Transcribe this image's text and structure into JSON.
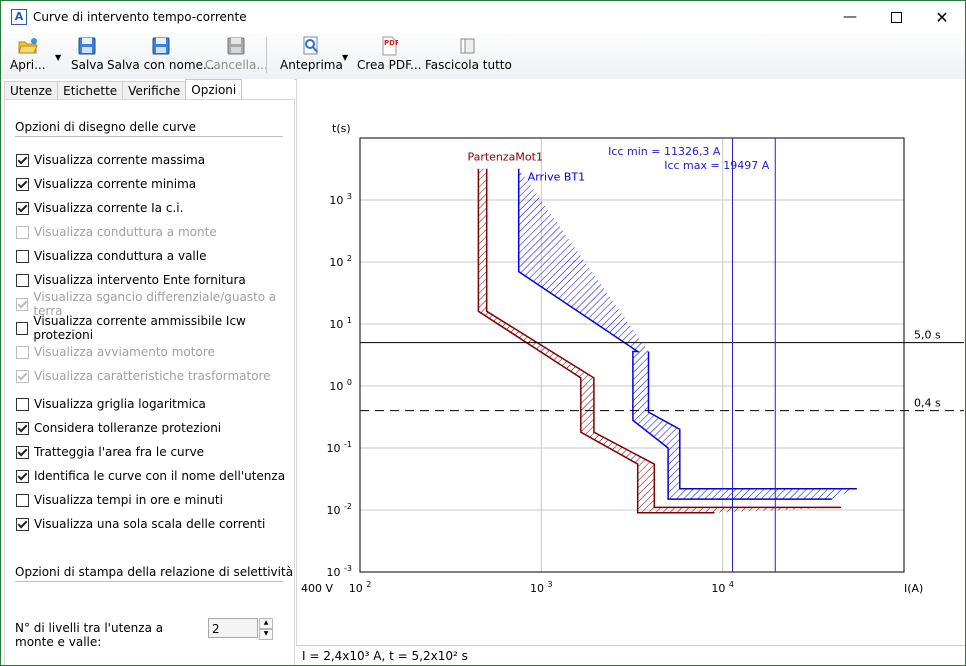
{
  "window": {
    "title": "Curve di intervento tempo-corrente"
  },
  "toolbar": {
    "open": "Apri...",
    "save": "Salva",
    "save_as": "Salva con nome...",
    "delete": "Cancella...",
    "preview": "Anteprima",
    "pdf": "Crea PDF...",
    "collate": "Fascicola tutto"
  },
  "tabs": [
    "Utenze",
    "Etichette",
    "Verifiche",
    "Opzioni"
  ],
  "drawing": {
    "title": "Opzioni di disegno delle curve",
    "options": [
      {
        "label": "Visualizza corrente massima",
        "checked": true,
        "enabled": true
      },
      {
        "label": "Visualizza corrente minima",
        "checked": true,
        "enabled": true
      },
      {
        "label": "Visualizza corrente Ia c.i.",
        "checked": true,
        "enabled": true
      },
      {
        "label": "Visualizza conduttura a monte",
        "checked": false,
        "enabled": false
      },
      {
        "label": "Visualizza conduttura a valle",
        "checked": false,
        "enabled": true
      },
      {
        "label": "Visualizza intervento Ente fornitura",
        "checked": false,
        "enabled": true
      },
      {
        "label": "Visualizza sgancio differenziale/guasto a terra",
        "checked": true,
        "enabled": false
      },
      {
        "label": "Visualizza corrente ammissibile Icw protezioni",
        "checked": false,
        "enabled": true
      },
      {
        "label": "Visualizza avviamento motore",
        "checked": false,
        "enabled": false
      },
      {
        "label": "Visualizza caratteristiche trasformatore",
        "checked": true,
        "enabled": false
      },
      {
        "label": "Visualizza griglia logaritmica",
        "checked": false,
        "enabled": true
      },
      {
        "label": "Considera tolleranze protezioni",
        "checked": true,
        "enabled": true
      },
      {
        "label": "Tratteggia l'area fra le curve",
        "checked": true,
        "enabled": true
      },
      {
        "label": "Identifica le curve con il nome dell'utenza",
        "checked": true,
        "enabled": true
      },
      {
        "label": "Visualizza tempi in ore e minuti",
        "checked": false,
        "enabled": true
      },
      {
        "label": "Visualizza una sola scala delle correnti",
        "checked": true,
        "enabled": true
      }
    ]
  },
  "print": {
    "title": "Opzioni di stampa della relazione di selettività",
    "levels_label": "N° di livelli tra l'utenza a monte e valle:",
    "levels_value": "2"
  },
  "chart_data": {
    "type": "line",
    "xlabel": "I(A)",
    "ylabel": "t(s)",
    "voltage": "400 V",
    "x_scale": "log",
    "y_scale": "log",
    "xlim": [
      100,
      100000
    ],
    "ylim": [
      0.001,
      10000
    ],
    "x_ticks": [
      {
        "base": "10",
        "exp": "2"
      },
      {
        "base": "10",
        "exp": "3"
      },
      {
        "base": "10",
        "exp": "4"
      }
    ],
    "y_ticks": [
      {
        "base": "10",
        "exp": "3"
      },
      {
        "base": "10",
        "exp": "2"
      },
      {
        "base": "10",
        "exp": "1"
      },
      {
        "base": "10",
        "exp": "0"
      },
      {
        "base": "10",
        "exp": "-1"
      },
      {
        "base": "10",
        "exp": "-2"
      },
      {
        "base": "10",
        "exp": "-3"
      }
    ],
    "grid": true,
    "hlines": [
      {
        "t": 5.0,
        "label": "5,0 s",
        "style": "solid"
      },
      {
        "t": 0.4,
        "label": "0,4 s",
        "style": "dashed"
      }
    ],
    "vlines": [
      {
        "I": 11326.3,
        "label": "Icc min = 11326,3 A"
      },
      {
        "I": 19497,
        "label": "Icc max = 19497 A"
      }
    ],
    "series": [
      {
        "name": "PartenzaMot1",
        "color": "#800000",
        "left": [
          [
            450,
            3200
          ],
          [
            450,
            16
          ],
          [
            1650,
            1.35
          ],
          [
            1650,
            0.18
          ],
          [
            3400,
            0.055
          ],
          [
            3400,
            0.009
          ],
          [
            9000,
            0.009
          ]
        ],
        "right": [
          [
            500,
            3200
          ],
          [
            500,
            16
          ],
          [
            1950,
            1.35
          ],
          [
            1950,
            0.18
          ],
          [
            4200,
            0.055
          ],
          [
            4200,
            0.011
          ],
          [
            45000,
            0.011
          ]
        ]
      },
      {
        "name": "Arrive BT1",
        "color": "#0000e0",
        "left": [
          [
            750,
            3200
          ],
          [
            750,
            70
          ],
          [
            3400,
            3.6
          ],
          [
            3200,
            3.6
          ],
          [
            3200,
            0.28
          ],
          [
            5000,
            0.1
          ],
          [
            5000,
            0.015
          ],
          [
            40000,
            0.015
          ]
        ],
        "right": [
          [
            3900,
            3.6
          ],
          [
            3900,
            0.38
          ],
          [
            5800,
            0.2
          ],
          [
            5800,
            0.022
          ],
          [
            55000,
            0.022
          ]
        ]
      }
    ]
  },
  "status": {
    "text": "I = 2,4x10³ A, t = 5,2x10² s"
  }
}
